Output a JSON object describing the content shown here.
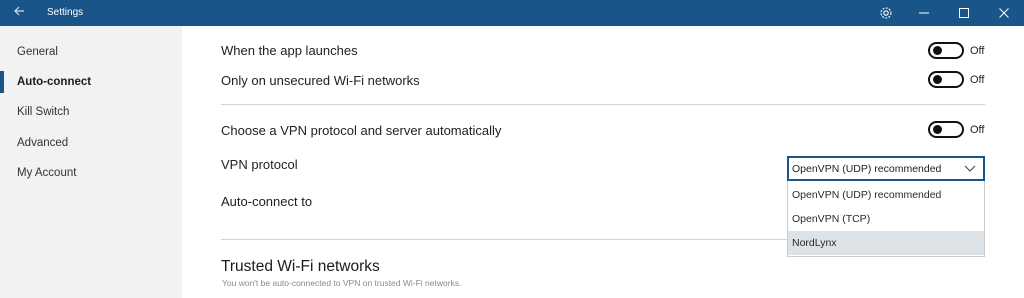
{
  "window": {
    "title": "Settings",
    "back_icon": "back-arrow-icon",
    "gear_icon": "gear-icon",
    "minimize_icon": "minimize-icon",
    "maximize_icon": "maximize-icon",
    "close_icon": "close-icon"
  },
  "sidebar": {
    "active_index": 1,
    "items": [
      {
        "label": "General"
      },
      {
        "label": "Auto-connect"
      },
      {
        "label": "Kill Switch"
      },
      {
        "label": "Advanced"
      },
      {
        "label": "My Account"
      }
    ]
  },
  "settings": {
    "app_launch": {
      "label": "When the app launches",
      "state": "Off"
    },
    "unsecured_wifi": {
      "label": "Only on unsecured Wi-Fi networks",
      "state": "Off"
    },
    "auto_protocol": {
      "label": "Choose a VPN protocol and server automatically",
      "state": "Off"
    },
    "vpn_protocol": {
      "label": "VPN protocol",
      "selected": "OpenVPN (UDP) recommended",
      "options": [
        "OpenVPN (UDP) recommended",
        "OpenVPN (TCP)",
        "NordLynx"
      ],
      "highlighted_option": "NordLynx"
    },
    "auto_connect_to": {
      "label": "Auto-connect to"
    }
  },
  "trusted_wifi": {
    "title": "Trusted Wi-Fi networks",
    "subtitle": "You won't be auto-connected to VPN on trusted Wi-Fi networks."
  },
  "colors": {
    "accent": "#1a5589",
    "sidebar_bg": "#f2f2f2",
    "highlight": "#dde2e6"
  }
}
